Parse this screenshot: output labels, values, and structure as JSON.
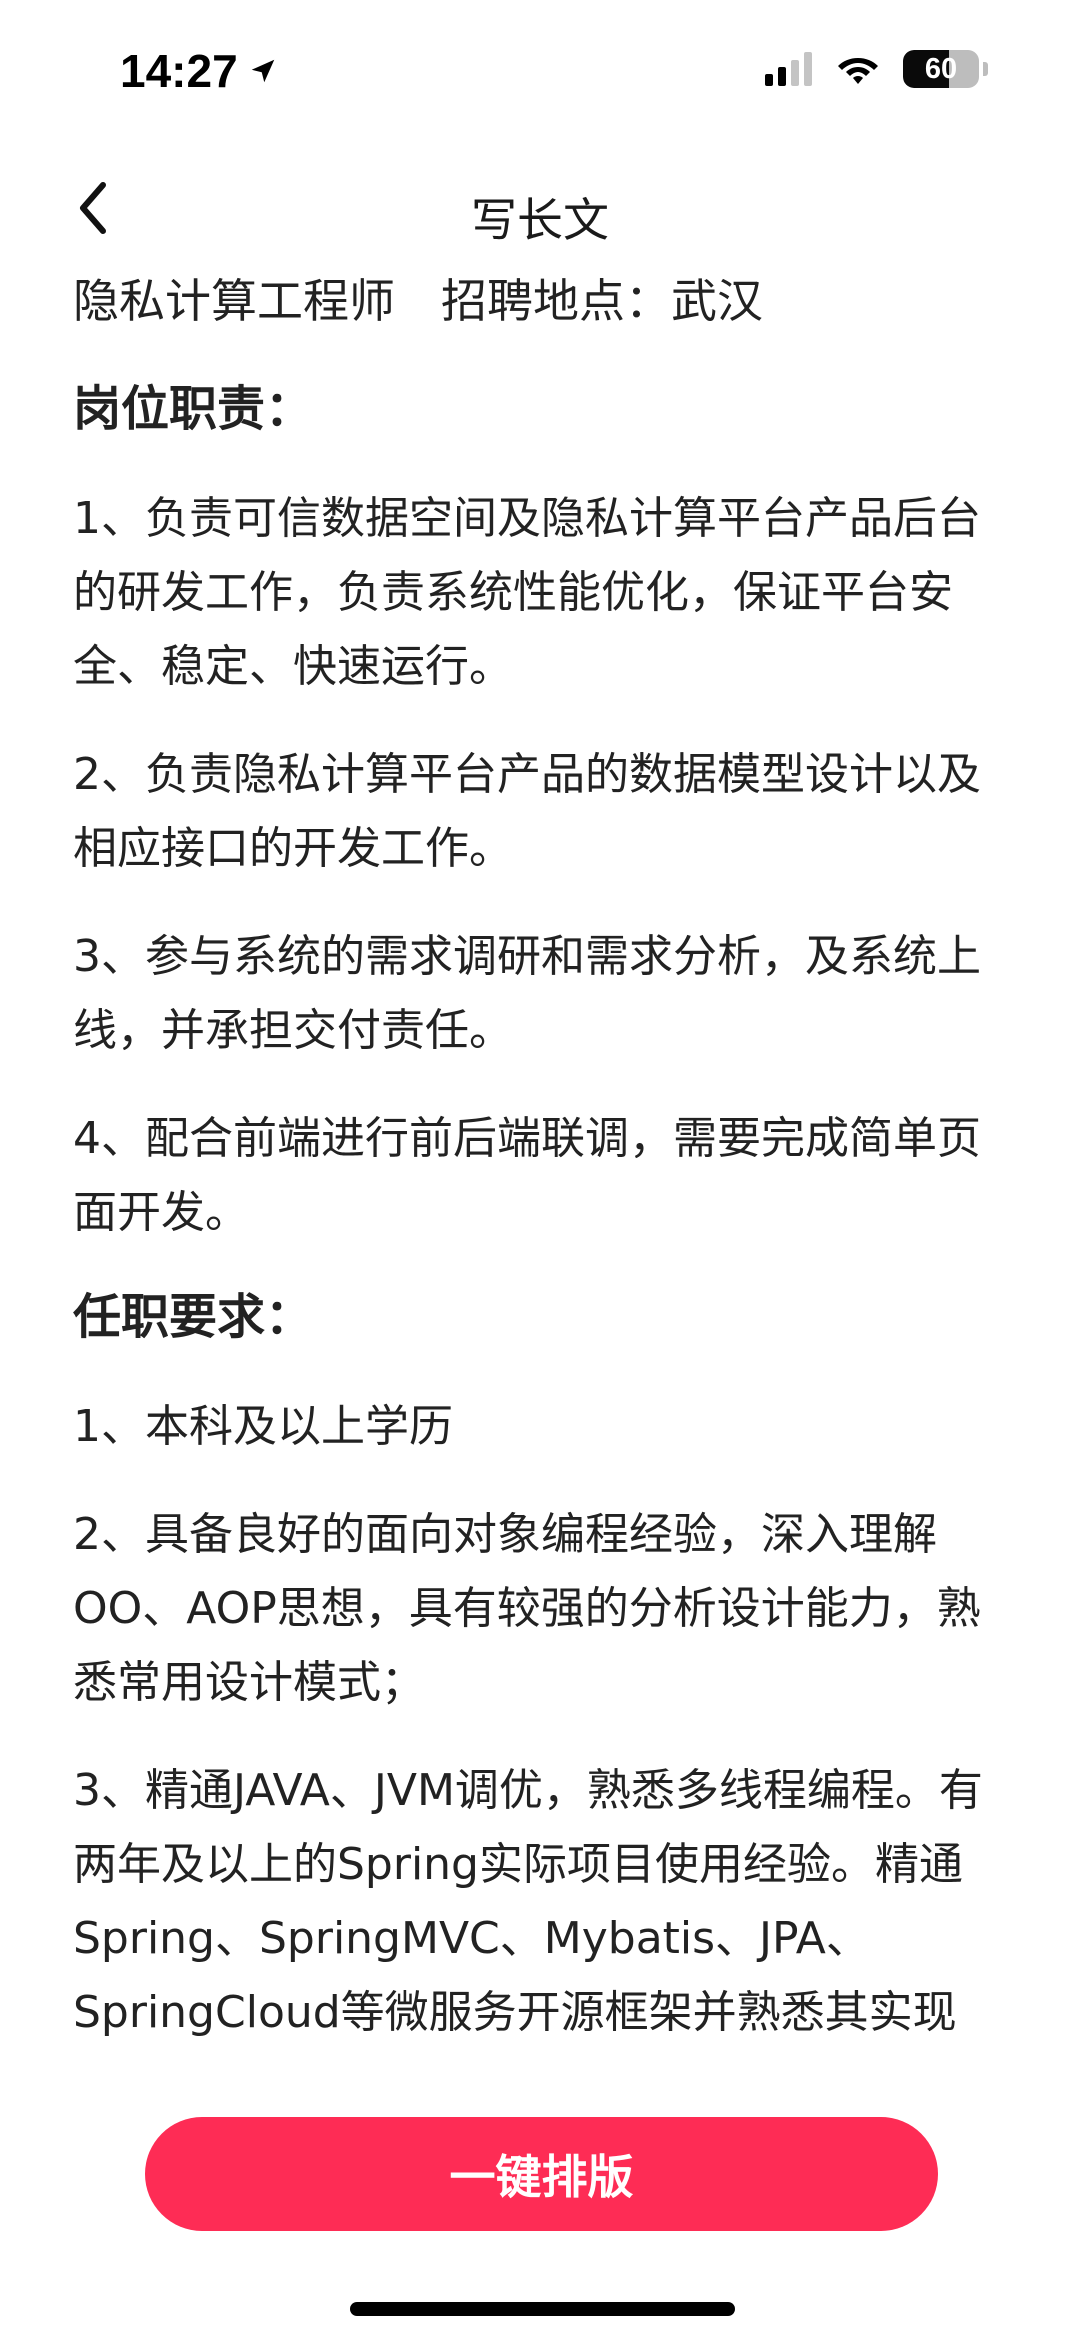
{
  "status_bar": {
    "time": "14:27",
    "battery_level": "60",
    "battery_fraction": 0.6
  },
  "nav": {
    "title": "写长文"
  },
  "article": {
    "job_title": "隐私计算工程师",
    "job_location": "招聘地点：武汉",
    "sections": [
      {
        "heading": "岗位职责：",
        "items": [
          "1、负责可信数据空间及隐私计算平台产品后台的研发工作，负责系统性能优化，保证平台安全、稳定、快速运行。",
          "2、负责隐私计算平台产品的数据模型设计以及相应接口的开发工作。",
          "3、参与系统的需求调研和需求分析，及系统上线，并承担交付责任。",
          "4、配合前端进行前后端联调，需要完成简单页面开发。"
        ]
      },
      {
        "heading": "任职要求：",
        "items": [
          "1、本科及以上学历",
          "2、具备良好的面向对象编程经验，深入理解OO、AOP思想，具有较强的分析设计能力，熟悉常用设计模式；",
          "3、精通JAVA、JVM调优，熟悉多线程编程。有两年及以上的Spring实际项目使用经验。精通Spring、SpringMVC、Mybatis、JPA、SpringCloud等微服务开源框架并熟悉其实现"
        ]
      }
    ]
  },
  "actions": {
    "format_label": "一键排版"
  },
  "colors": {
    "accent": "#fe2c55",
    "text": "#222222",
    "background": "#ffffff"
  },
  "icons": {
    "back": "chevron-left-icon",
    "location": "location-arrow-icon",
    "cellular": "cellular-signal-icon",
    "wifi": "wifi-icon",
    "battery": "battery-icon"
  }
}
